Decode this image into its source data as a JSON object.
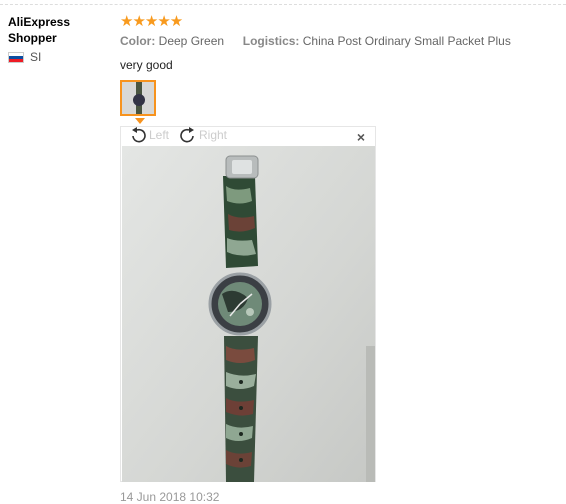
{
  "user": {
    "name_line1": "AliExpress",
    "name_line2": "Shopper",
    "country_code": "SI"
  },
  "review": {
    "stars": "★★★★★",
    "color_label": "Color:",
    "color_value": "Deep Green",
    "logistics_label": "Logistics:",
    "logistics_value": "China Post Ordinary Small Packet Plus",
    "comment": "very good",
    "date": "14 Jun 2018 10:32"
  },
  "viewer": {
    "rotate_left_label": "Left",
    "rotate_right_label": "Right",
    "close_glyph": "×"
  },
  "colors": {
    "star": "#f89a1e",
    "thumb_border": "#f7931e"
  }
}
